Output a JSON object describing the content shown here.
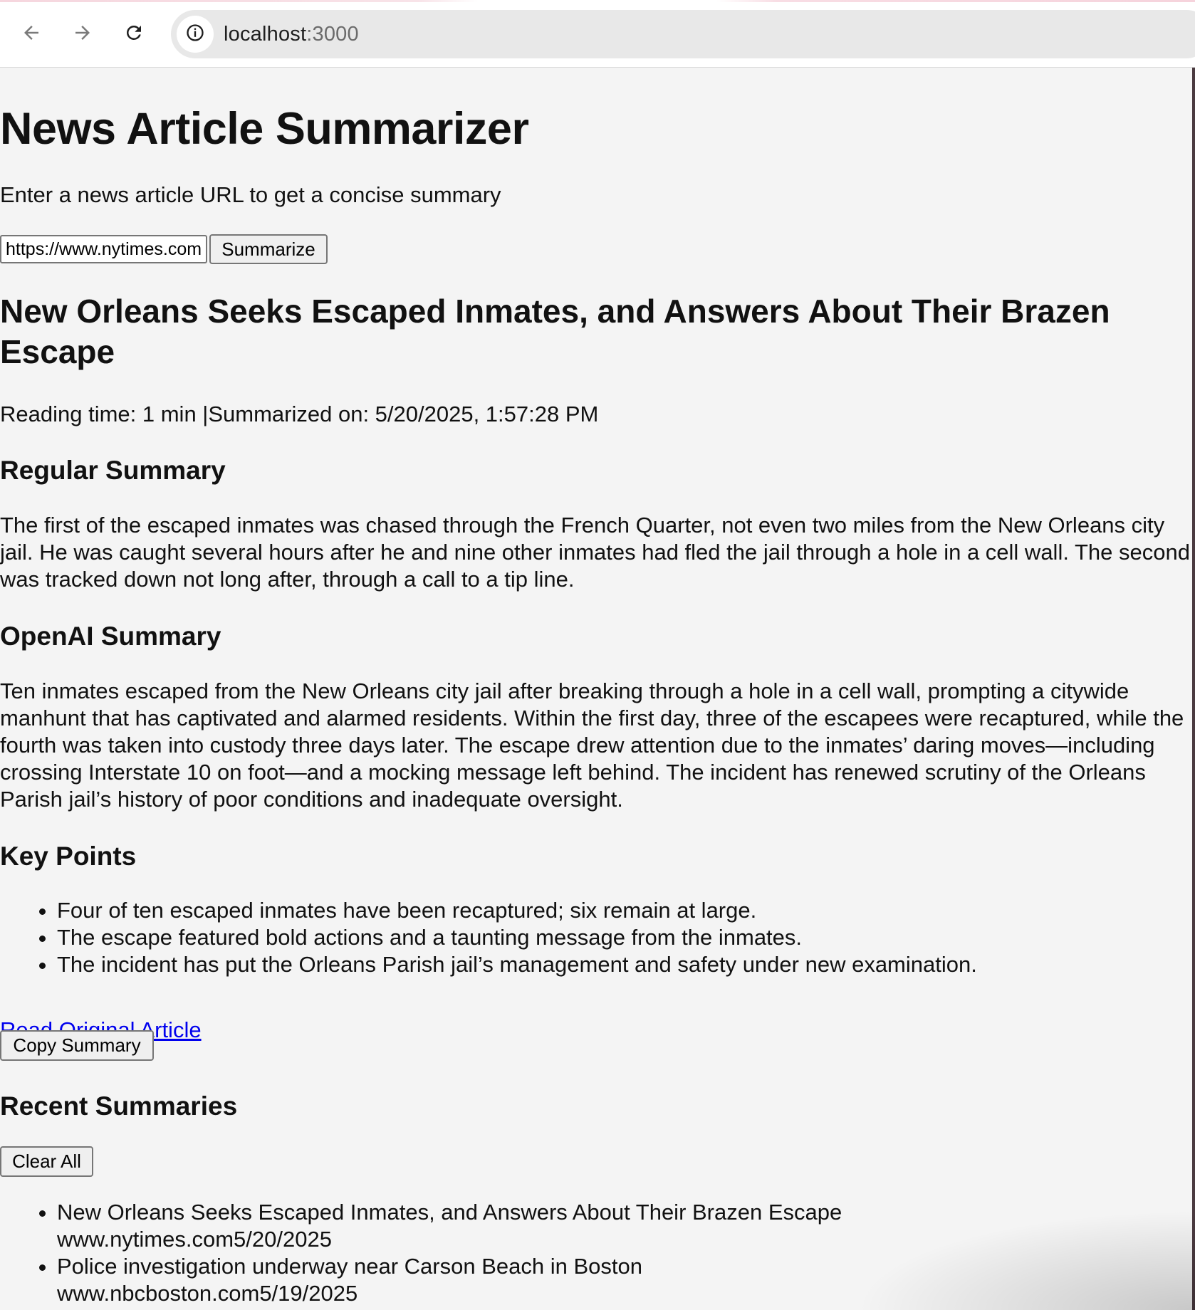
{
  "browser": {
    "url_host": "localhost",
    "url_port": ":3000"
  },
  "app": {
    "title": "News Article Summarizer",
    "subtitle": "Enter a news article URL to get a concise summary",
    "url_input_value": "https://www.nytimes.com/",
    "summarize_label": "Summarize"
  },
  "article": {
    "title": "New Orleans Seeks Escaped Inmates, and Answers About Their Brazen Escape",
    "meta": "Reading time: 1 min |Summarized on: 5/20/2025, 1:57:28 PM",
    "regular_heading": "Regular Summary",
    "regular_summary": "The first of the escaped inmates was chased through the French Quarter, not even two miles from the New Orleans city jail. He was caught several hours after he and nine other inmates had fled the jail through a hole in a cell wall. The second was tracked down not long after, through a call to a tip line.",
    "openai_heading": "OpenAI Summary",
    "openai_summary": "Ten inmates escaped from the New Orleans city jail after breaking through a hole in a cell wall, prompting a citywide manhunt that has captivated and alarmed residents. Within the first day, three of the escapees were recaptured, while the fourth was taken into custody three days later. The escape drew attention due to the inmates’ daring moves—including crossing Interstate 10 on foot—and a mocking message left behind. The incident has renewed scrutiny of the Orleans Parish jail’s history of poor conditions and inadequate oversight.",
    "key_points_heading": "Key Points",
    "key_points": [
      "Four of ten escaped inmates have been recaptured; six remain at large.",
      "The escape featured bold actions and a taunting message from the inmates.",
      "The incident has put the Orleans Parish jail’s management and safety under new examination."
    ],
    "read_original_label": "Read Original Article",
    "copy_label": "Copy Summary"
  },
  "recent": {
    "heading": "Recent Summaries",
    "clear_label": "Clear All",
    "items": [
      {
        "title": "New Orleans Seeks Escaped Inmates, and Answers About Their Brazen Escape",
        "domain": "www.nytimes.com",
        "date": "5/20/2025"
      },
      {
        "title": "Police investigation underway near Carson Beach in Boston",
        "domain": "www.nbcboston.com",
        "date": "5/19/2025"
      }
    ]
  },
  "icons": {
    "back": "arrow-left-icon",
    "forward": "arrow-right-icon",
    "reload": "reload-icon",
    "site_info": "info-icon"
  },
  "colors": {
    "page_bg": "#f4f4f4",
    "link": "#0000ee",
    "omnibox_bg": "#e8e8e8"
  }
}
